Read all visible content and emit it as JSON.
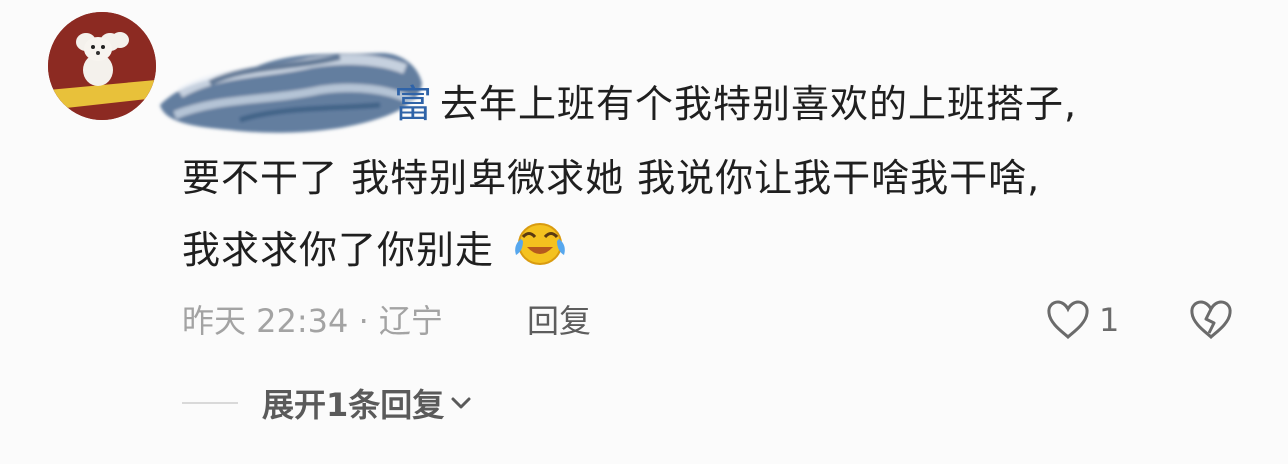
{
  "comment": {
    "username_visible": "富",
    "text_line1": "去年上班有个我特别喜欢的上班搭子,",
    "text_line2": "要不干了 我特别卑微求她 我说你让我干啥我干啥,",
    "text_line3": "我求求你了你别走",
    "emoji": "crying-laughing-emoji",
    "meta": "昨天 22:34 · 辽宁",
    "reply_label": "回复",
    "like_count": "1",
    "expand_label": "展开1条回复"
  },
  "colors": {
    "background": "#fbfbfb",
    "username": "#2f63a8",
    "text": "#1f1f1f",
    "meta": "#a3a3a3",
    "avatar_bg": "#8c2a22"
  },
  "icons": [
    "heart-outline-icon",
    "broken-heart-icon",
    "chevron-down-icon"
  ]
}
